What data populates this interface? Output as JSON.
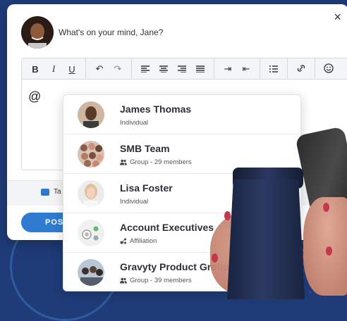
{
  "composer": {
    "close_glyph": "×",
    "prompt": "What's on your mind, Jane?",
    "editor_text": "@",
    "tag_label": "Ta",
    "post_label": "POS"
  },
  "toolbar": {
    "bold": "B",
    "italic": "I",
    "underline": "U",
    "undo": "↶",
    "redo": "↷",
    "indent": "⇥",
    "outdent": "⇤"
  },
  "mentions": [
    {
      "name": "James Thomas",
      "sub": "Individual",
      "icon": "none"
    },
    {
      "name": "SMB Team",
      "sub": "Group - 29 members",
      "icon": "group-icon"
    },
    {
      "name": "Lisa Foster",
      "sub": "Individual",
      "icon": "none"
    },
    {
      "name": "Account Executives",
      "sub": "Affiliation",
      "icon": "affiliation-icon"
    },
    {
      "name": "Gravyty Product Group",
      "sub": "Group - 39 members",
      "icon": "group-icon"
    }
  ],
  "colors": {
    "brand_blue": "#2f7bd1",
    "background": "#1f3b78"
  }
}
